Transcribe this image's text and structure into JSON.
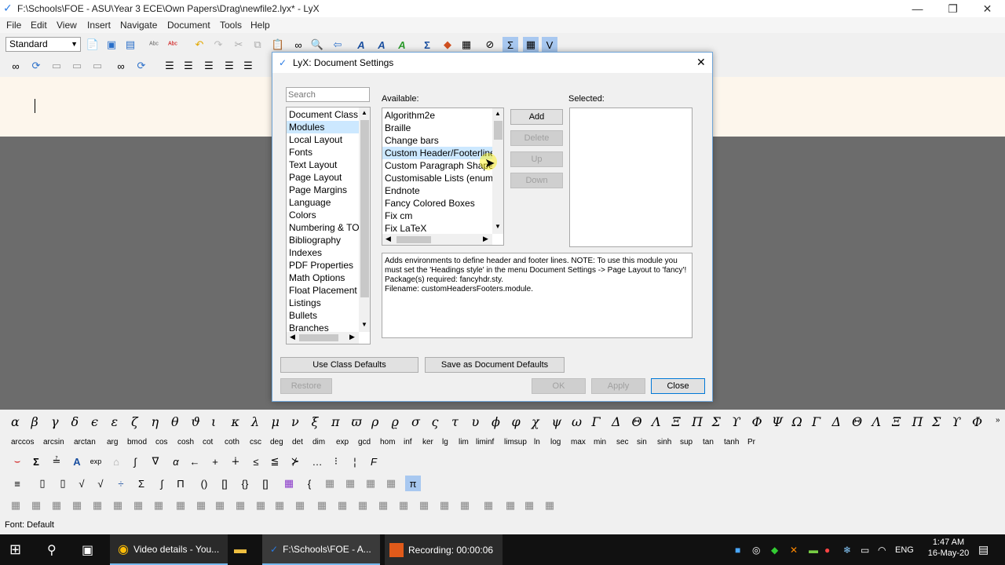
{
  "window": {
    "title": "F:\\Schools\\FOE - ASU\\Year 3 ECE\\Own Papers\\Drag\\newfile2.lyx* - LyX",
    "min": "—",
    "max": "❐",
    "close": "✕"
  },
  "menu": [
    "File",
    "Edit",
    "View",
    "Insert",
    "Navigate",
    "Document",
    "Tools",
    "Help"
  ],
  "toolbar": {
    "style_combo": "Standard"
  },
  "dialog": {
    "title": "LyX: Document Settings",
    "close": "✕",
    "search_placeholder": "Search",
    "categories": [
      "Document Class",
      "Modules",
      "Local Layout",
      "Fonts",
      "Text Layout",
      "Page Layout",
      "Page Margins",
      "Language",
      "Colors",
      "Numbering & TOC",
      "Bibliography",
      "Indexes",
      "PDF Properties",
      "Math Options",
      "Float Placement",
      "Listings",
      "Bullets",
      "Branches"
    ],
    "available_label": "Available:",
    "selected_label": "Selected:",
    "available": [
      "Algorithm2e",
      "Braille",
      "Change bars",
      "Custom Header/Footerlines",
      "Custom Paragraph Shapes",
      "Customisable Lists (enumitem)",
      "Endnote",
      "Fancy Colored Boxes",
      "Fix cm",
      "Fix LaTeX"
    ],
    "buttons": {
      "add": "Add",
      "delete": "Delete",
      "up": "Up",
      "down": "Down"
    },
    "description": "Adds environments to define header and footer lines. NOTE: To use this module you must set the 'Headings style' in the menu Document Settings -> Page Layout to 'fancy'!\nPackage(s) required: fancyhdr.sty.\nFilename: customHeadersFooters.module.",
    "use_class_defaults": "Use Class Defaults",
    "save_defaults": "Save as Document Defaults",
    "restore": "Restore",
    "ok": "OK",
    "apply": "Apply",
    "close_btn": "Close"
  },
  "greek": [
    "α",
    "β",
    "γ",
    "δ",
    "ϵ",
    "ε",
    "ζ",
    "η",
    "θ",
    "ϑ",
    "ι",
    "κ",
    "λ",
    "μ",
    "ν",
    "ξ",
    "π",
    "ϖ",
    "ρ",
    "ϱ",
    "σ",
    "ς",
    "τ",
    "υ",
    "ϕ",
    "φ",
    "χ",
    "ψ",
    "ω",
    "Γ",
    "Δ",
    "Θ",
    "Λ",
    "Ξ",
    "Π",
    "Σ",
    "ϒ",
    "Φ",
    "Ψ",
    "Ω",
    "Γ",
    "Δ",
    "Θ",
    "Λ",
    "Ξ",
    "Π",
    "Σ",
    "ϒ",
    "Φ"
  ],
  "functions": [
    "arccos",
    "arcsin",
    "arctan",
    "arg",
    "bmod",
    "cos",
    "cosh",
    "cot",
    "coth",
    "csc",
    "deg",
    "det",
    "dim",
    "exp",
    "gcd",
    "hom",
    "inf",
    "ker",
    "lg",
    "lim",
    "liminf",
    "limsup",
    "ln",
    "log",
    "max",
    "min",
    "sec",
    "sin",
    "sinh",
    "sup",
    "tan",
    "tanh",
    "Pr"
  ],
  "statusbar": "Font: Default",
  "taskbar": {
    "chrome": "Video details - You...",
    "lyx": "F:\\Schools\\FOE - A...",
    "recording": "Recording:  00:00:06",
    "lang": "ENG",
    "time": "1:47 AM",
    "date": "16-May-20"
  }
}
